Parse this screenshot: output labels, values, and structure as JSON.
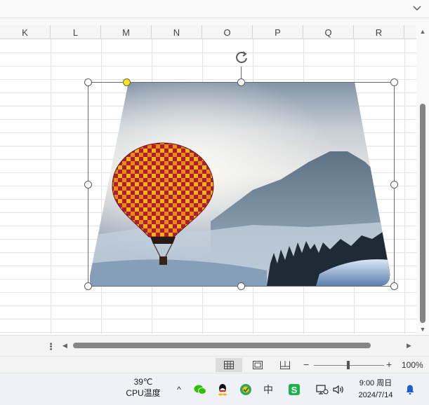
{
  "ribbon": {
    "collapse_icon": "chevron-down-icon"
  },
  "columns": [
    "K",
    "L",
    "M",
    "N",
    "O",
    "P",
    "Q",
    "R"
  ],
  "status_bar": {
    "views": [
      "normal-view",
      "page-layout-view",
      "page-break-view"
    ],
    "zoom_minus": "−",
    "zoom_plus": "+",
    "zoom_level": "100%",
    "zoom_value": 100
  },
  "taskbar": {
    "temperature": "39℃",
    "cpu_label": "CPU温度",
    "overflow_icon": "^",
    "ime_label": "中",
    "time": "9:00 周日",
    "date": "2024/7/14"
  },
  "image": {
    "description_icon": "hot-air-balloon-image",
    "colors": {
      "sky_top": "#6f8499",
      "sky_mid": "#d7dbe0",
      "balloon_red": "#b01e2a",
      "balloon_yellow": "#f3b21b",
      "snow": "#cfe0f3"
    }
  }
}
